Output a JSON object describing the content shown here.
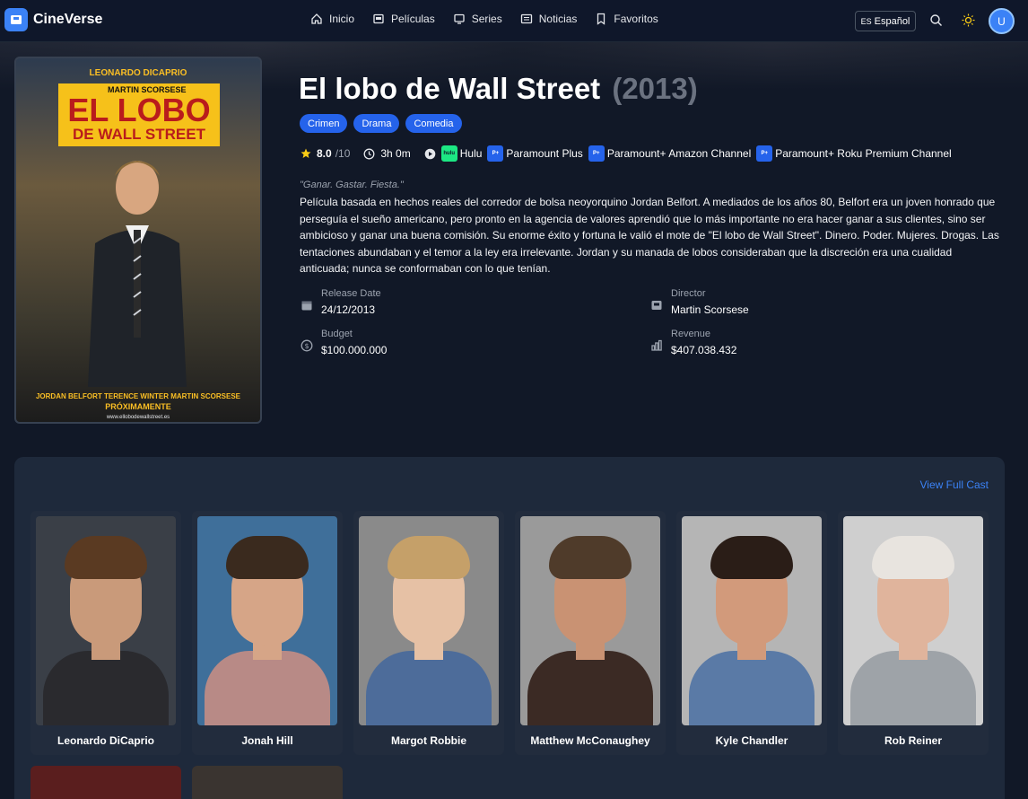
{
  "app": {
    "name": "CineVerse"
  },
  "nav": {
    "items": [
      {
        "label": "Inicio",
        "icon": "home-icon"
      },
      {
        "label": "Películas",
        "icon": "film-icon"
      },
      {
        "label": "Series",
        "icon": "tv-icon"
      },
      {
        "label": "Noticias",
        "icon": "newspaper-icon"
      },
      {
        "label": "Favoritos",
        "icon": "bookmark-icon"
      }
    ],
    "language": {
      "code": "ES",
      "label": "Español"
    },
    "user_initial": "U"
  },
  "movie": {
    "title": "El lobo de Wall Street",
    "year": "(2013)",
    "genres": [
      "Crimen",
      "Drama",
      "Comedia"
    ],
    "rating": "8.0",
    "rating_max": "/10",
    "runtime": "3h 0m",
    "providers": [
      {
        "name": "Hulu",
        "logo_text": "hulu"
      },
      {
        "name": "Paramount Plus",
        "logo_text": "P+"
      },
      {
        "name": "Paramount+ Amazon Channel",
        "logo_text": "P+"
      },
      {
        "name": "Paramount+ Roku Premium Channel",
        "logo_text": "P+"
      }
    ],
    "tagline": "\"Ganar. Gastar. Fiesta.\"",
    "overview": "Película basada en hechos reales del corredor de bolsa neoyorquino Jordan Belfort. A mediados de los años 80, Belfort era un joven honrado que perseguía el sueño americano, pero pronto en la agencia de valores aprendió que lo más importante no era hacer ganar a sus clientes, sino ser ambicioso y ganar una buena comisión. Su enorme éxito y fortuna le valió el mote de \"El lobo de Wall Street\". Dinero. Poder. Mujeres. Drogas. Las tentaciones abundaban y el temor a la ley era irrelevante. Jordan y su manada de lobos consideraban que la discreción era una cualidad anticuada; nunca se conformaban con lo que tenían.",
    "facts": {
      "release_label": "Release Date",
      "release_value": "24/12/2013",
      "director_label": "Director",
      "director_value": "Martin Scorsese",
      "budget_label": "Budget",
      "budget_value": "$100.000.000",
      "revenue_label": "Revenue",
      "revenue_value": "$407.038.432"
    }
  },
  "poster": {
    "actor": "LEONARDO DICAPRIO",
    "director_line": "MARTIN SCORSESE",
    "title_line1": "EL LOBO",
    "title_line2": "DE WALL STREET",
    "credits": "JORDAN BELFORT   TERENCE WINTER   MARTIN SCORSESE",
    "coming": "PRÓXIMAMENTE",
    "url": "www.ellobodewallstreet.es"
  },
  "cast": {
    "view_full_cast": "View Full Cast",
    "members": [
      {
        "name": "Leonardo DiCaprio",
        "bg": "#3a3f47",
        "skin": "#c99a7a",
        "hair": "#5a3a22",
        "shirt": "#2a2a2e"
      },
      {
        "name": "Jonah Hill",
        "bg": "#3f6f9a",
        "skin": "#d6a587",
        "hair": "#3a2a1e",
        "shirt": "#b88a86"
      },
      {
        "name": "Margot Robbie",
        "bg": "#8a8a8a",
        "skin": "#e6c1a5",
        "hair": "#c5a069",
        "shirt": "#4d6c9a"
      },
      {
        "name": "Matthew McConaughey",
        "bg": "#9a9a9a",
        "skin": "#c99273",
        "hair": "#4f3b2a",
        "shirt": "#3b2a24"
      },
      {
        "name": "Kyle Chandler",
        "bg": "#b5b5b5",
        "skin": "#d29a7b",
        "hair": "#2a1d17",
        "shirt": "#5a7aa6"
      },
      {
        "name": "Rob Reiner",
        "bg": "#cfcfcf",
        "skin": "#e0b49c",
        "hair": "#e8e4df",
        "shirt": "#9ea3a8"
      }
    ]
  }
}
